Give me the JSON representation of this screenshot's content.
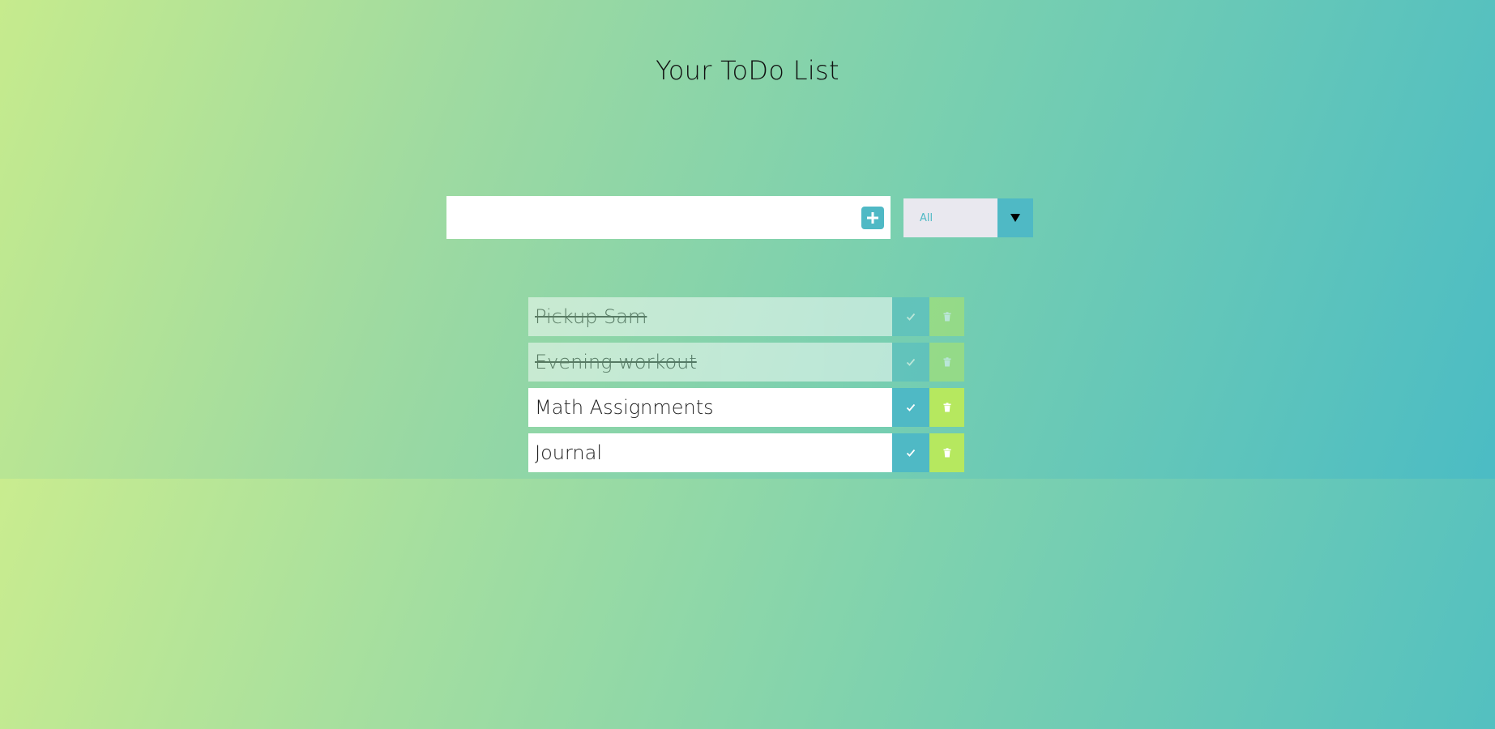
{
  "page": {
    "title": "Your ToDo List"
  },
  "input": {
    "value": "",
    "placeholder": ""
  },
  "add_button": {
    "icon": "plus-icon"
  },
  "filter": {
    "selected": "All",
    "icon": "caret-down-icon"
  },
  "todos": [
    {
      "text": "Pickup Sam",
      "completed": true
    },
    {
      "text": "Evening workout",
      "completed": true
    },
    {
      "text": "Math Assignments",
      "completed": false
    },
    {
      "text": "Journal",
      "completed": false
    }
  ],
  "colors": {
    "accent": "#4fb9c5",
    "trash": "#b6e85f",
    "select_bg": "#e9e8ef"
  }
}
